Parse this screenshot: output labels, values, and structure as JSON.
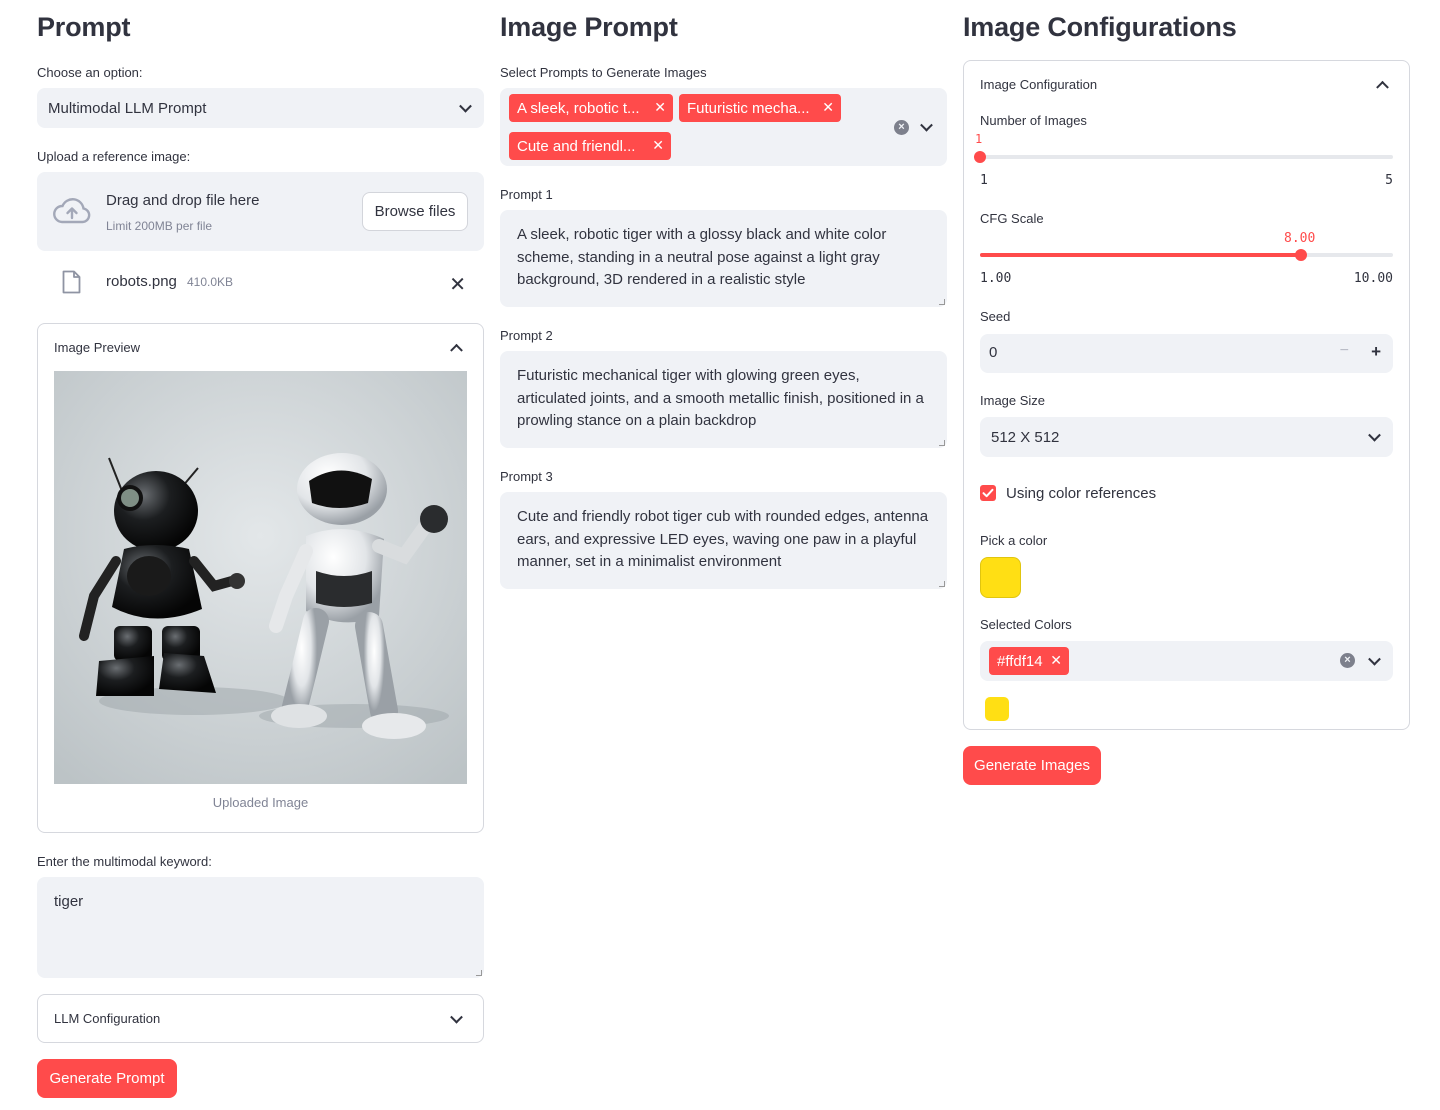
{
  "prompt_col": {
    "title": "Prompt",
    "choose_label": "Choose an option:",
    "choose_value": "Multimodal LLM Prompt",
    "upload_label": "Upload a reference image:",
    "upload_main": "Drag and drop file here",
    "upload_limit": "Limit 200MB per file",
    "browse_label": "Browse files",
    "file_name": "robots.png",
    "file_size": "410.0KB",
    "preview_title": "Image Preview",
    "image_caption": "Uploaded Image",
    "keyword_label": "Enter the multimodal keyword:",
    "keyword_value": "tiger",
    "llm_config_title": "LLM Configuration",
    "generate_prompt_label": "Generate Prompt"
  },
  "image_prompt_col": {
    "title": "Image Prompt",
    "select_label": "Select Prompts to Generate Images",
    "tags": [
      "A sleek, robotic t...",
      "Futuristic mecha...",
      "Cute and friendl..."
    ],
    "prompts": [
      {
        "label": "Prompt 1",
        "text": "A sleek, robotic tiger with a glossy black and white color scheme, standing in a neutral pose against a light gray background, 3D rendered in a realistic style"
      },
      {
        "label": "Prompt 2",
        "text": "Futuristic mechanical tiger with glowing green eyes, articulated joints, and a smooth metallic finish, positioned in a prowling stance on a plain backdrop"
      },
      {
        "label": "Prompt 3",
        "text": "Cute and friendly robot tiger cub with rounded edges, antenna ears, and expressive LED eyes, waving one paw in a playful manner, set in a minimalist environment"
      }
    ]
  },
  "config_col": {
    "title": "Image Configurations",
    "expander_title": "Image Configuration",
    "num_images": {
      "label": "Number of Images",
      "value": "1",
      "min": "1",
      "max": "5",
      "fraction": 0.0
    },
    "cfg_scale": {
      "label": "CFG Scale",
      "value": "8.00",
      "min": "1.00",
      "max": "10.00",
      "fraction": 0.7778
    },
    "seed": {
      "label": "Seed",
      "value": "0",
      "minus": "−",
      "plus": "+"
    },
    "image_size": {
      "label": "Image Size",
      "value": "512 X 512"
    },
    "color_ref": {
      "label": "Using color references",
      "checked": true
    },
    "pick_color_label": "Pick a color",
    "picked_color": "#ffdf14",
    "selected_colors_label": "Selected Colors",
    "selected_colors": [
      "#ffdf14"
    ],
    "generate_images_label": "Generate Images"
  },
  "colors": {
    "accent": "#ff4b4b",
    "input_bg": "#f0f2f6",
    "text": "#31333f",
    "muted": "#808495"
  }
}
